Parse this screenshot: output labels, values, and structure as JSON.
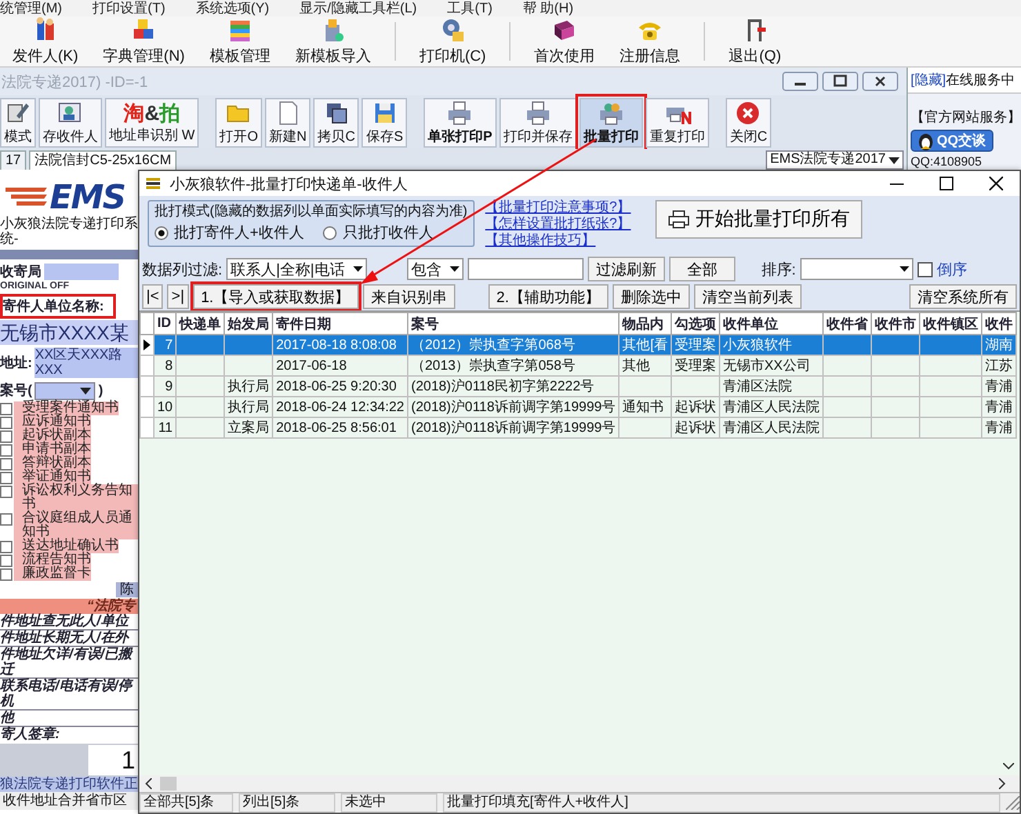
{
  "menu": [
    "统管理(M)",
    "打印设置(T)",
    "系统选项(Y)",
    "显示/隐藏工具栏(L)",
    "工具(T)",
    "帮 助(H)"
  ],
  "toolbar": [
    "发件人(K)",
    "字典管理(N)",
    "模板管理",
    "新模板导入",
    "打印机(C)",
    "首次使用",
    "注册信息",
    "退出(Q)"
  ],
  "document_window": {
    "title": "法院专递2017) -ID=-1",
    "toolbar": [
      {
        "label": "模式",
        "bold": false,
        "highlighted": false
      },
      {
        "label": "存收件人",
        "bold": false,
        "highlighted": false
      },
      {
        "label": "地址串识别 W",
        "logo": "淘&拍",
        "bold": false,
        "highlighted": false
      },
      {
        "label": "打开O",
        "bold": false,
        "highlighted": false
      },
      {
        "label": "新建N",
        "bold": false,
        "highlighted": false
      },
      {
        "label": "拷贝C",
        "bold": false,
        "highlighted": false
      },
      {
        "label": "保存S",
        "bold": false,
        "highlighted": false
      },
      {
        "label": "单张打印P",
        "bold": true,
        "highlighted": false
      },
      {
        "label": "打印并保存",
        "bold": false,
        "highlighted": false
      },
      {
        "label": "批量打印",
        "bold": true,
        "highlighted": true
      },
      {
        "label": "重复打印",
        "bold": false,
        "highlighted": false
      },
      {
        "label": "关闭C",
        "bold": false,
        "highlighted": false
      }
    ],
    "tabs": [
      {
        "label": "17",
        "selected": false
      },
      {
        "label": "法院信封C5-25x16CM",
        "selected": true
      }
    ],
    "template_select": "EMS法院专递2017",
    "form": {
      "logo": "EMS",
      "subtitle": "小灰狼法院专递打印系统-",
      "post_office_label": "收寄局",
      "original_label": "ORIGINAL OFF",
      "sender_label": "寄件人单位名称:",
      "sender_value": "无锡市XXXX某",
      "address_label": "地址:",
      "address_value": "XX区天XXX路XXX",
      "case_label": "案号(",
      "case_close": ")",
      "documents": [
        {
          "label": "受理案件通知书",
          "checked": false
        },
        {
          "label": "应诉通知书",
          "checked": false
        },
        {
          "label": "起诉状副本",
          "checked": false
        },
        {
          "label": "申请书副本",
          "checked": false
        },
        {
          "label": "答辩状副本",
          "checked": false
        },
        {
          "label": "举证通知书",
          "checked": false
        },
        {
          "label": "诉讼权利义务告知书",
          "checked": false
        },
        {
          "label": "合议庭组成人员通知书",
          "checked": false
        },
        {
          "label": "送达地址确认书",
          "checked": false
        },
        {
          "label": "流程告知书",
          "checked": false
        },
        {
          "label": "廉政监督卡",
          "checked": false
        }
      ],
      "signer": "陈",
      "banner": "“法院专",
      "reasons": [
        "件地址查无此人/单位",
        "件地址长期无人/在外",
        "件地址欠详/有误/已搬迁",
        "联系电话/电话有误/停机"
      ],
      "other": "他",
      "signature_label": "寄人签章:",
      "count": "1",
      "footer": "狼法院专递打印软件正",
      "merge_note": "收件地址合并省市区"
    }
  },
  "service_panel": {
    "hide_link": "[隐藏]",
    "title": "在线服务中",
    "section": "【官方网站服务】",
    "qq_button": "QQ交谈",
    "qq_number": "QQ:4108905"
  },
  "dialog": {
    "title": "小灰狼软件-批量打印快递单-收件人",
    "mode_group": {
      "title": "批打模式(隐藏的数据列以单面实际填写的内容为准)",
      "options": [
        {
          "label": "批打寄件人+收件人",
          "selected": true
        },
        {
          "label": "只批打收件人",
          "selected": false
        }
      ]
    },
    "links": [
      "【批量打印注意事项?】",
      "【怎样设置批打纸张?】",
      "【其他操作技巧】"
    ],
    "start_button": "开始批量打印所有",
    "filter": {
      "label": "数据列过滤:",
      "column": "联系人|全称|电话",
      "operator": "包含",
      "refresh_button": "过滤刷新",
      "all_button": "全部",
      "sort_label": "排序:",
      "reverse": {
        "label": "倒序",
        "checked": false
      }
    },
    "actions": [
      {
        "label": "|<",
        "highlighted": false
      },
      {
        "label": ">|",
        "highlighted": false
      },
      {
        "label": "1.【导入或获取数据】",
        "highlighted": true
      },
      {
        "label": "来自识别串",
        "highlighted": false
      },
      {
        "label": "2.【辅助功能】",
        "highlighted": false
      },
      {
        "label": "删除选中",
        "highlighted": false
      },
      {
        "label": "清空当前列表",
        "highlighted": false
      },
      {
        "label": "清空系统所有",
        "highlighted": false
      }
    ],
    "table": {
      "columns": [
        "ID",
        "快递单",
        "始发局",
        "寄件日期",
        "案号",
        "物品内",
        "勾选项",
        "收件单位",
        "收件省",
        "收件市",
        "收件镇区",
        "收件"
      ],
      "rows": [
        {
          "selected": true,
          "cells": [
            "7",
            "",
            "",
            "2017-08-18 8:08:08",
            "（2012）崇执查字第068号",
            "其他[看",
            "受理案",
            "小灰狼软件",
            "",
            "",
            "",
            "湖南"
          ]
        },
        {
          "selected": false,
          "cells": [
            "8",
            "",
            "",
            "2017-06-18",
            "（2013）崇执查字第058号",
            "其他",
            "受理案",
            "无锡市XX公司",
            "",
            "",
            "",
            "江苏"
          ]
        },
        {
          "selected": false,
          "cells": [
            "9",
            "",
            "执行局",
            "2018-06-25 9:20:30",
            "(2018)沪0118民初字第2222号",
            "",
            "",
            "青浦区法院",
            "",
            "",
            "",
            "青浦"
          ]
        },
        {
          "selected": false,
          "cells": [
            "10",
            "",
            "执行局",
            "2018-06-24 12:34:22",
            "(2018)沪0118诉前调字第19999号",
            "通知书",
            "起诉状",
            "青浦区人民法院",
            "",
            "",
            "",
            "青浦"
          ]
        },
        {
          "selected": false,
          "cells": [
            "11",
            "",
            "立案局",
            "2018-06-25 8:56:01",
            "(2018)沪0118诉前调字第19999号",
            "",
            "起诉状",
            "青浦区人民法院",
            "",
            "",
            "",
            "青浦"
          ]
        }
      ]
    },
    "status_bar": [
      "全部共[5]条",
      "列出[5]条",
      "未选中",
      "批量打印填充[寄件人+收件人]"
    ]
  }
}
